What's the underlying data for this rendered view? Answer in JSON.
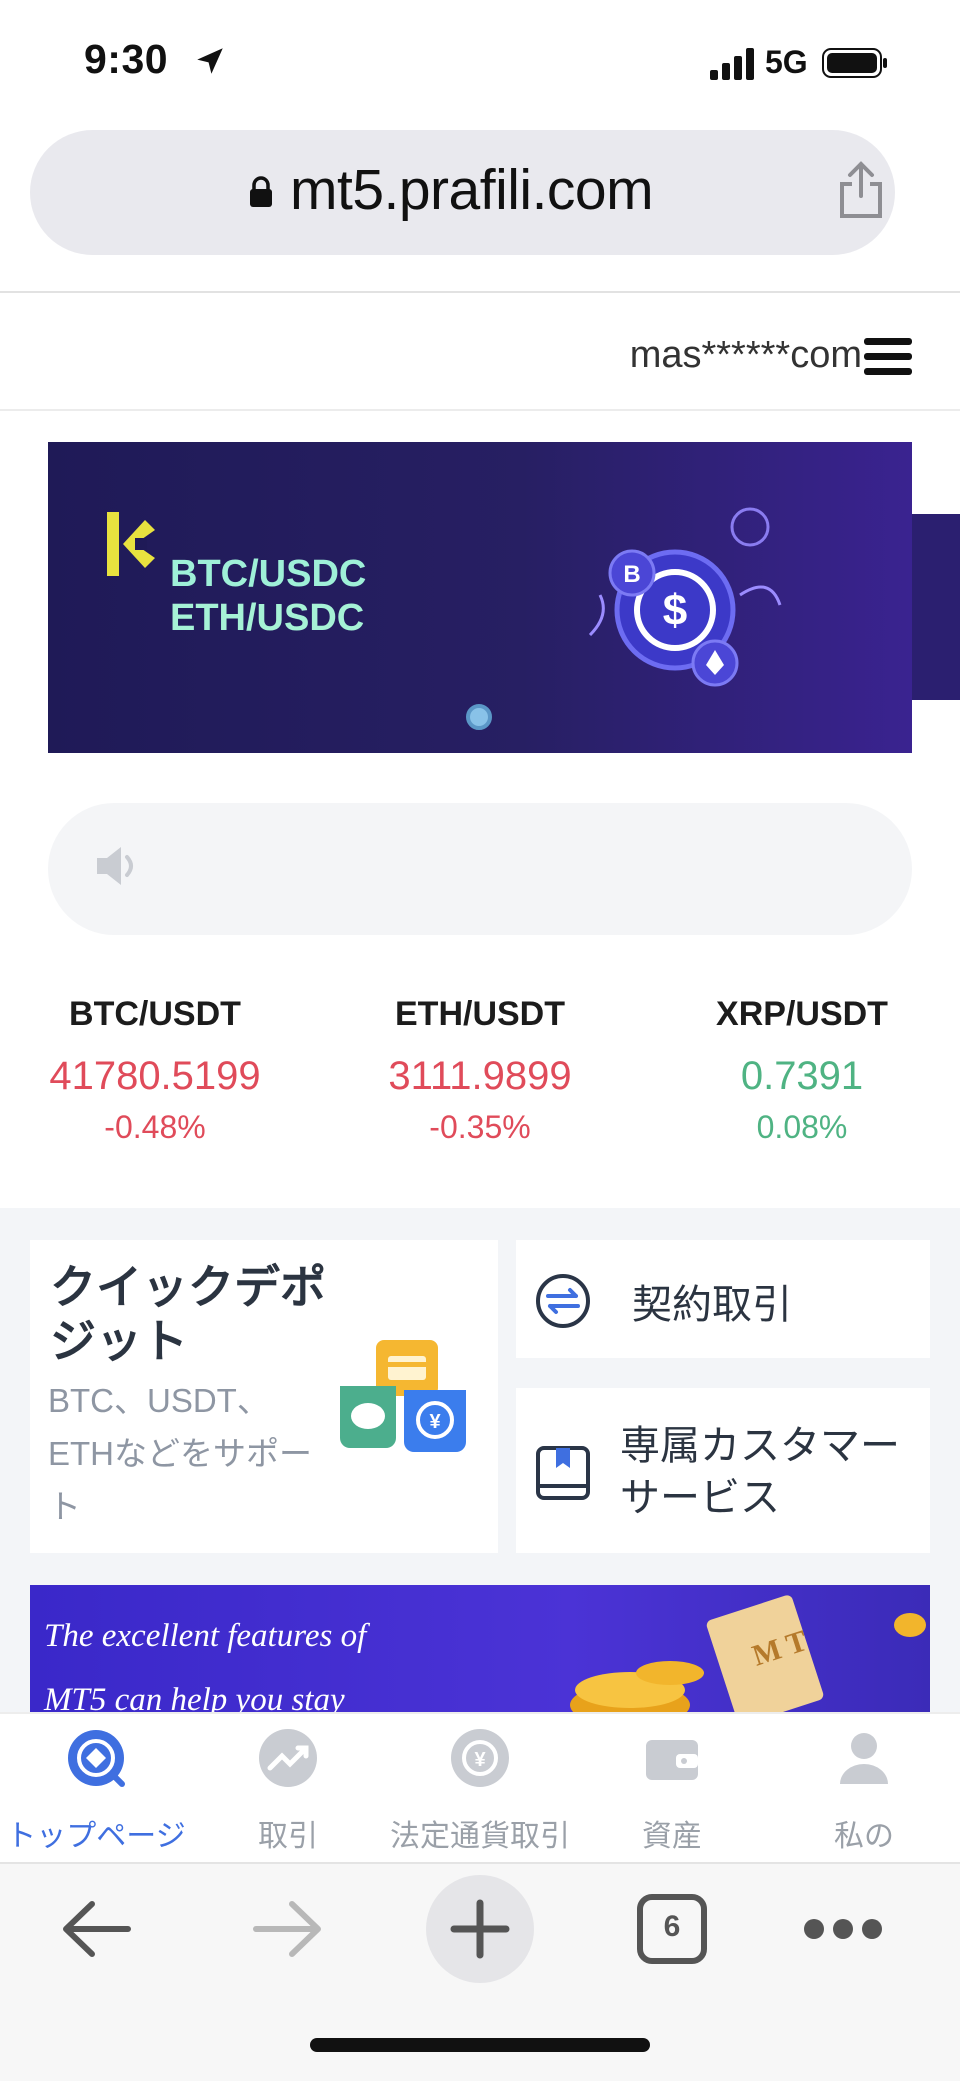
{
  "status_bar": {
    "time": "9:30",
    "network": "5G"
  },
  "browser": {
    "url": "mt5.prafili.com"
  },
  "header": {
    "account": "mas******com"
  },
  "banner": {
    "line1": "BTC/USDC",
    "line2": "ETH/USDC"
  },
  "tickers": [
    {
      "pair": "BTC/USDT",
      "price": "41780.5199",
      "change": "-0.48%",
      "trend": "down"
    },
    {
      "pair": "ETH/USDT",
      "price": "3111.9899",
      "change": "-0.35%",
      "trend": "down"
    },
    {
      "pair": "XRP/USDT",
      "price": "0.7391",
      "change": "0.08%",
      "trend": "up"
    }
  ],
  "quick_deposit": {
    "title": "クイックデポジット",
    "subtitle": "BTC、USDT、ETHなどをサポート"
  },
  "side_actions": {
    "contract": "契約取引",
    "service": "専属カスタマーサービス"
  },
  "promo": {
    "line1": "The excellent features of",
    "line2": "MT5 can help you stay"
  },
  "tabs": [
    {
      "label": "トップページ",
      "icon": "home-target-icon",
      "active": true
    },
    {
      "label": "取引",
      "icon": "trend-icon",
      "active": false
    },
    {
      "label": "法定通貨取引",
      "icon": "currency-exchange-icon",
      "active": false
    },
    {
      "label": "資産",
      "icon": "wallet-icon",
      "active": false
    },
    {
      "label": "私の",
      "icon": "user-icon",
      "active": false
    }
  ],
  "toolbar": {
    "tab_count": "6"
  },
  "colors": {
    "up": "#4fb383",
    "down": "#e04b5a",
    "accent": "#3f6fe0"
  }
}
